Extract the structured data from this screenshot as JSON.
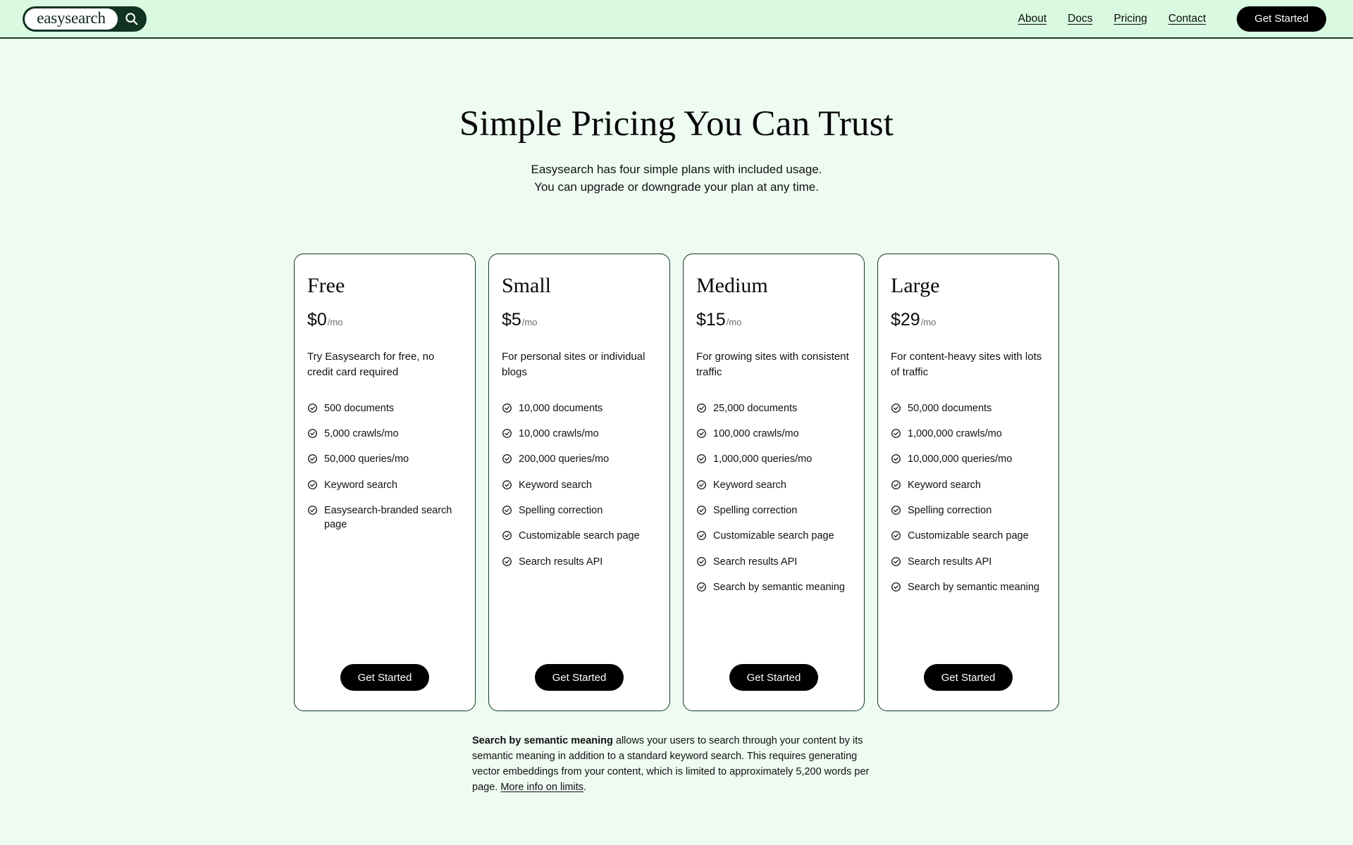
{
  "brand": {
    "logo_text": "easysearch",
    "logo_icon": "magnifier-icon",
    "logo_bg": "#113322"
  },
  "header": {
    "nav": [
      {
        "label": "About"
      },
      {
        "label": "Docs"
      },
      {
        "label": "Pricing"
      },
      {
        "label": "Contact"
      }
    ],
    "cta_label": "Get Started",
    "background": "#d9f9e0",
    "border_color": "#1a3d23"
  },
  "hero": {
    "title": "Simple Pricing You Can Trust",
    "subtitle_line1": "Easysearch has four simple plans with included usage.",
    "subtitle_line2": "You can upgrade or downgrade your plan at any time."
  },
  "plans": [
    {
      "name": "Free",
      "price": "$0",
      "period": "/mo",
      "description": "Try Easysearch for free, no credit card required",
      "features": [
        "500 documents",
        "5,000 crawls/mo",
        "50,000 queries/mo",
        "Keyword search",
        "Easysearch-branded search page"
      ],
      "cta_label": "Get Started"
    },
    {
      "name": "Small",
      "price": "$5",
      "period": "/mo",
      "description": "For personal sites or individual blogs",
      "features": [
        "10,000 documents",
        "10,000 crawls/mo",
        "200,000 queries/mo",
        "Keyword search",
        "Spelling correction",
        "Customizable search page",
        "Search results API"
      ],
      "cta_label": "Get Started"
    },
    {
      "name": "Medium",
      "price": "$15",
      "period": "/mo",
      "description": "For growing sites with consistent traffic",
      "features": [
        "25,000 documents",
        "100,000 crawls/mo",
        "1,000,000 queries/mo",
        "Keyword search",
        "Spelling correction",
        "Customizable search page",
        "Search results API",
        "Search by semantic meaning"
      ],
      "cta_label": "Get Started"
    },
    {
      "name": "Large",
      "price": "$29",
      "period": "/mo",
      "description": "For content-heavy sites with lots of traffic",
      "features": [
        "50,000 documents",
        "1,000,000 crawls/mo",
        "10,000,000 queries/mo",
        "Keyword search",
        "Spelling correction",
        "Customizable search page",
        "Search results API",
        "Search by semantic meaning"
      ],
      "cta_label": "Get Started"
    }
  ],
  "footnote": {
    "bold_lead": "Search by semantic meaning",
    "body": " allows your users to search through your content by its semantic meaning in addition to a standard keyword search. This requires generating vector embeddings from your content, which is limited to approximately 5,200 words per page. ",
    "link_label": "More info on limits",
    "trailing": "."
  },
  "colors": {
    "page_background": "#eefbf2",
    "card_background": "#ffffff",
    "card_border": "#0f3a23",
    "button_background": "#000000",
    "button_text": "#ffffff",
    "muted_text": "#6b6b6b"
  }
}
